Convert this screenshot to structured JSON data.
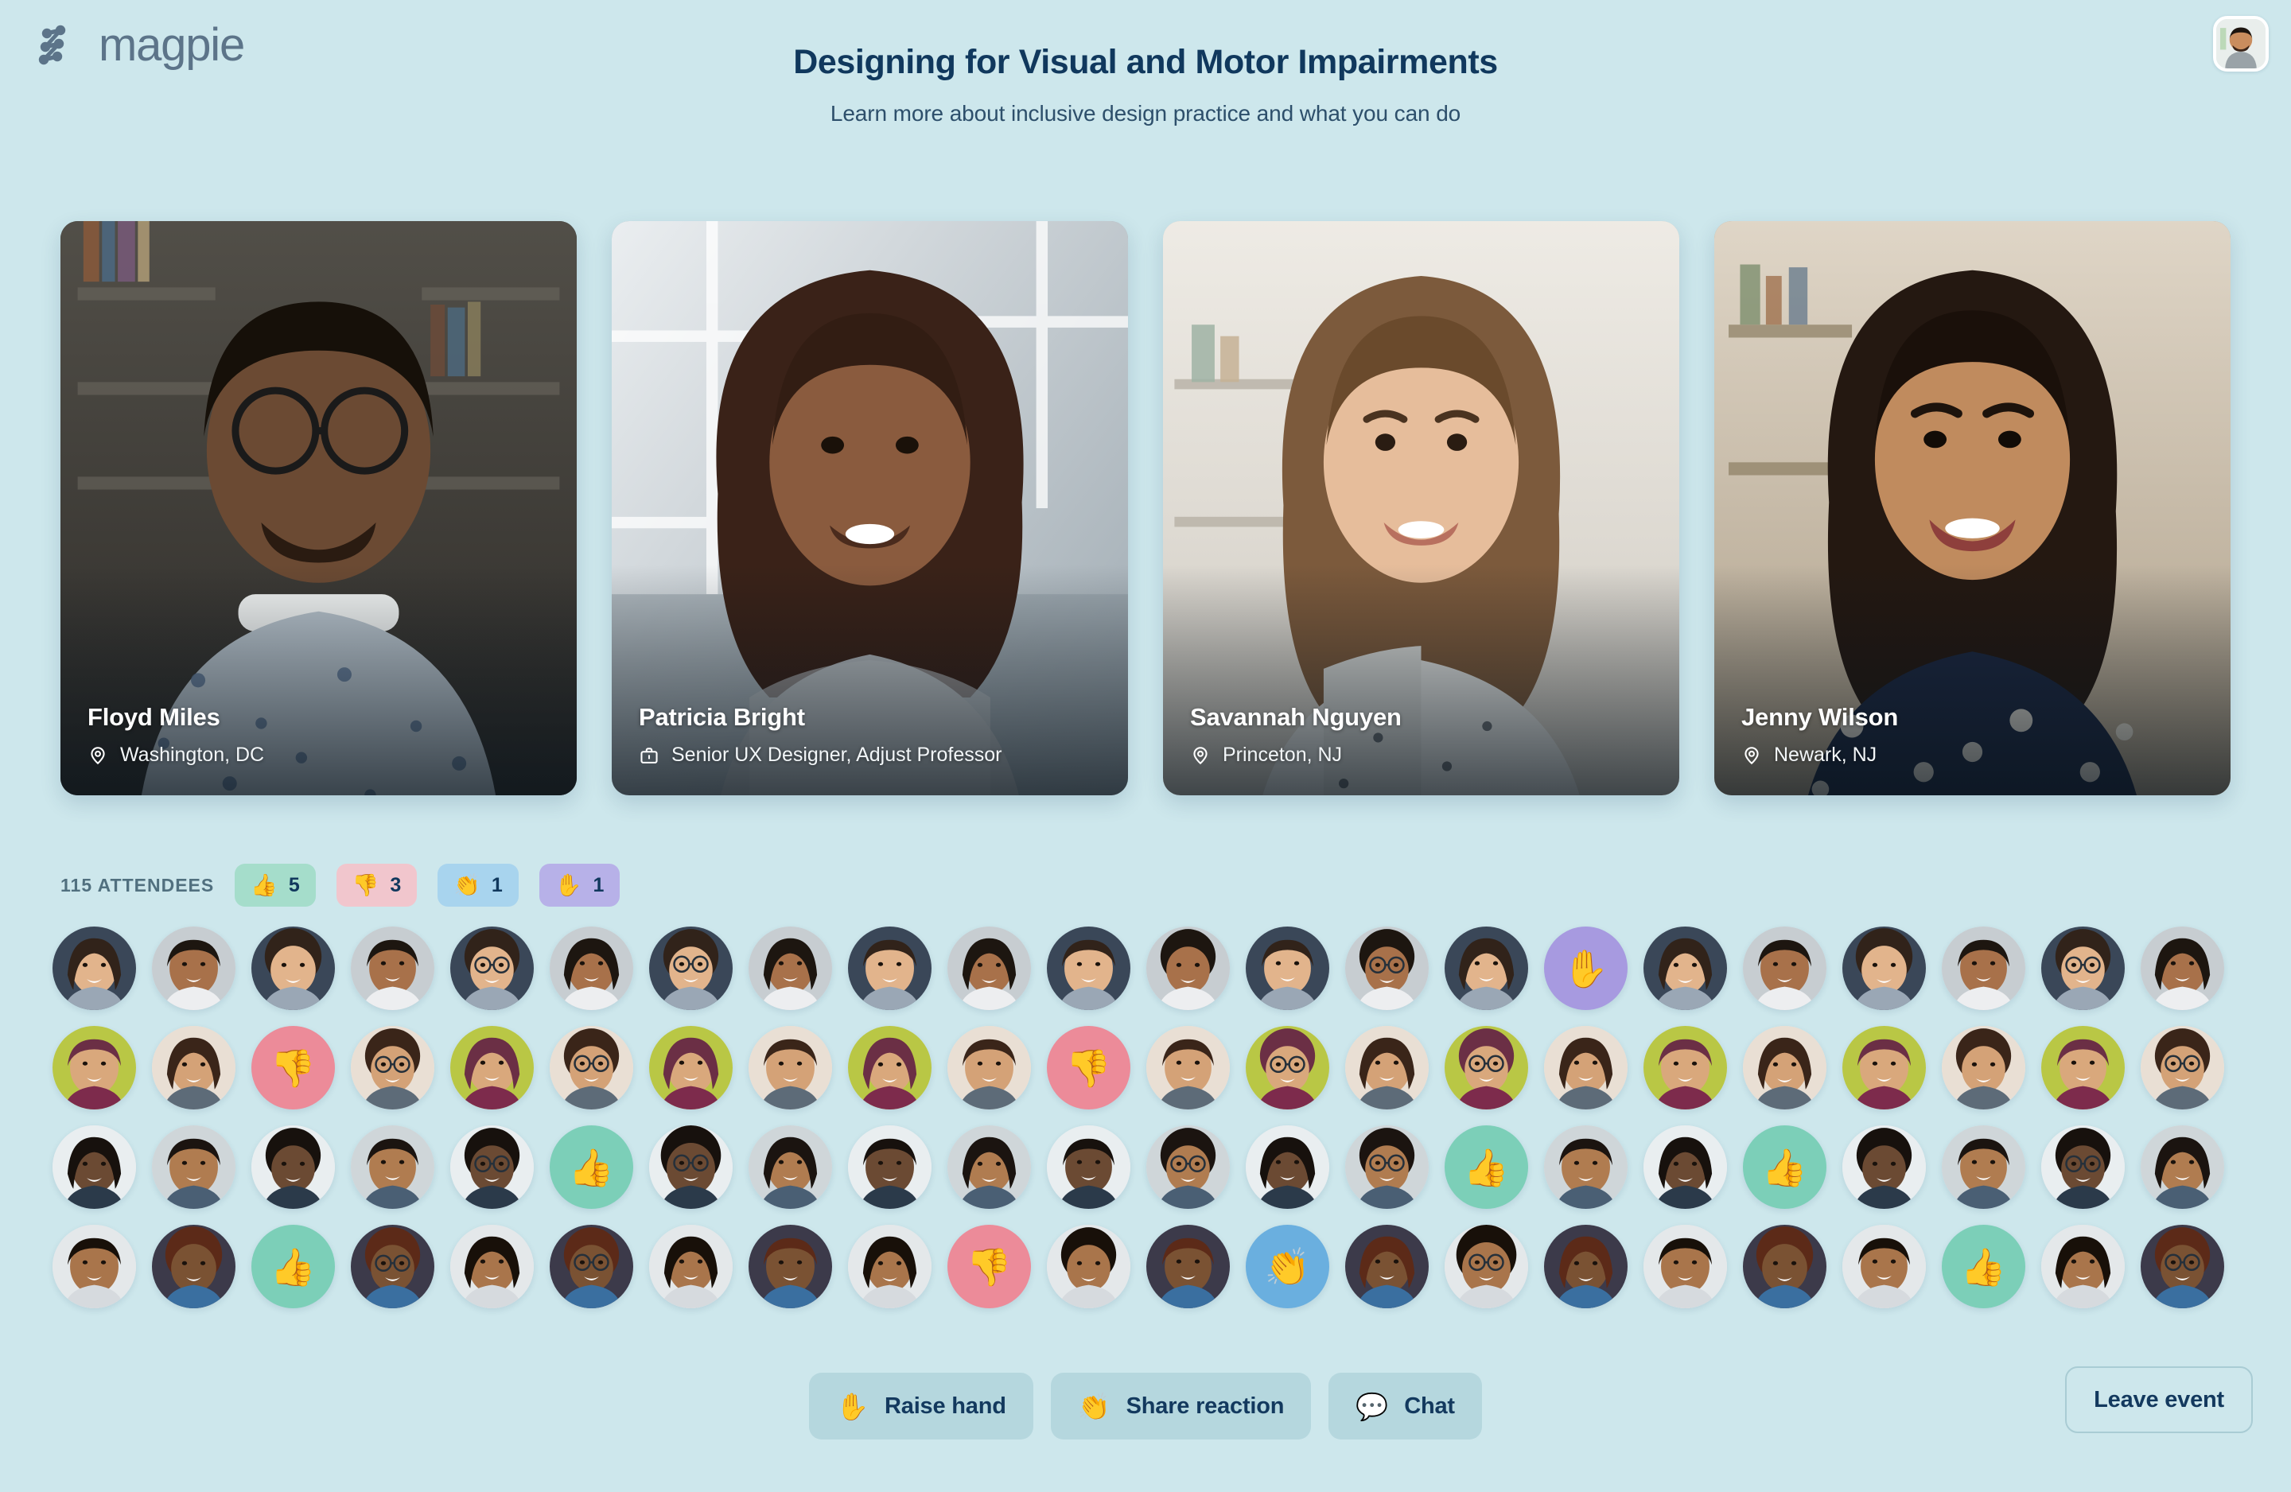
{
  "brand": {
    "name": "magpie",
    "mark_icon": "magpie-node-logo"
  },
  "header": {
    "title": "Designing for Visual and Motor Impairments",
    "subtitle": "Learn more about inclusive design practice and what you can do",
    "me_avatar_icon": "current-user-avatar"
  },
  "speakers": [
    {
      "name": "Floyd Miles",
      "detail": "Washington, DC",
      "detail_icon": "location-pin-icon",
      "skin": "#6b4a33",
      "bg_a": "#4c4a44",
      "bg_b": "#2d2b28",
      "shirt": "#b9c4cd"
    },
    {
      "name": "Patricia Bright",
      "detail": "Senior UX Designer, Adjust Professor",
      "detail_icon": "briefcase-icon",
      "skin": "#8a5b3e",
      "bg_a": "#d8dde2",
      "bg_b": "#9aa6ae",
      "shirt": "#b2b7bb"
    },
    {
      "name": "Savannah Nguyen",
      "detail": "Princeton, NJ",
      "detail_icon": "location-pin-icon",
      "skin": "#e6bd9b",
      "bg_a": "#e9e6e0",
      "bg_b": "#cdc8bf",
      "shirt": "#e3e4e2"
    },
    {
      "name": "Jenny Wilson",
      "detail": "Newark, NJ",
      "detail_icon": "location-pin-icon",
      "skin": "#c08b5e",
      "bg_a": "#dcd3c5",
      "bg_b": "#a99a83",
      "shirt": "#1c2740"
    }
  ],
  "attendees": {
    "count_label": "115 ATTENDEES",
    "reactions": [
      {
        "name": "thumbs-up",
        "emoji": "👍",
        "count": "5",
        "bg": "#a5ddcb"
      },
      {
        "name": "thumbs-down",
        "emoji": "👎",
        "count": "3",
        "bg": "#f1c6cd"
      },
      {
        "name": "clap",
        "emoji": "👏",
        "count": "1",
        "bg": "#a8d4ee"
      },
      {
        "name": "raised-hand",
        "emoji": "✋",
        "count": "1",
        "bg": "#b7b1e8"
      }
    ],
    "columns": 22,
    "reaction_colors": {
      "thumbs-up": "#7ccfb8",
      "thumbs-down": "#ec8b99",
      "clap": "#6aafdf",
      "raised-hand": "#a79ae0"
    },
    "rows": [
      {
        "row": 1,
        "reactions": [
          {
            "col": 16,
            "name": "raised-hand",
            "emoji": "✋"
          }
        ]
      },
      {
        "row": 2,
        "reactions": [
          {
            "col": 3,
            "name": "thumbs-down",
            "emoji": "👎"
          },
          {
            "col": 11,
            "name": "thumbs-down",
            "emoji": "👎"
          }
        ]
      },
      {
        "row": 3,
        "reactions": [
          {
            "col": 6,
            "name": "thumbs-up",
            "emoji": "👍"
          },
          {
            "col": 15,
            "name": "thumbs-up",
            "emoji": "👍"
          },
          {
            "col": 18,
            "name": "thumbs-up",
            "emoji": "👍"
          }
        ]
      },
      {
        "row": 4,
        "reactions": [
          {
            "col": 3,
            "name": "thumbs-up",
            "emoji": "👍"
          },
          {
            "col": 10,
            "name": "thumbs-down",
            "emoji": "👎"
          },
          {
            "col": 13,
            "name": "clap",
            "emoji": "👏"
          },
          {
            "col": 20,
            "name": "thumbs-up",
            "emoji": "👍"
          }
        ]
      }
    ],
    "face_palette": [
      {
        "skin": "#6b4a33",
        "bg": "#e9eef0",
        "hair": "#17110d",
        "shirt": "#2b3a4a"
      },
      {
        "skin": "#8a5b3e",
        "bg": "#59564e",
        "hair": "#2a1c12",
        "shirt": "#e6e2da"
      },
      {
        "skin": "#e6bd9b",
        "bg": "#dfe6e4",
        "hair": "#4a3526",
        "shirt": "#f0f1ef"
      },
      {
        "skin": "#a8714a",
        "bg": "#c7cdd1",
        "hair": "#1d1610",
        "shirt": "#edeef0"
      },
      {
        "skin": "#7a5233",
        "bg": "#3c3a4a",
        "hair": "#5c2a18",
        "shirt": "#3a6fa0"
      },
      {
        "skin": "#c08b5e",
        "bg": "#f0ebe6",
        "hair": "#241a12",
        "shirt": "#e7d9d3"
      },
      {
        "skin": "#8a5b3e",
        "bg": "#5c4433",
        "hair": "#1a120c",
        "shirt": "#e2c3cd"
      },
      {
        "skin": "#d9a87c",
        "bg": "#b9c745",
        "hair": "#6b2f45",
        "shirt": "#7d2b4c"
      },
      {
        "skin": "#c89060",
        "bg": "#d3d8da",
        "hair": "#221811",
        "shirt": "#8a9299"
      },
      {
        "skin": "#e8c6a4",
        "bg": "#e7e9e5",
        "hair": "#b08a57",
        "shirt": "#7a3a72"
      },
      {
        "skin": "#dbb089",
        "bg": "#93b544",
        "hair": "#2b1d14",
        "shirt": "#2d3947"
      },
      {
        "skin": "#b07c50",
        "bg": "#cfd6d9",
        "hair": "#1b1410",
        "shirt": "#4a5f74"
      },
      {
        "skin": "#f0cfae",
        "bg": "#eceee9",
        "hair": "#5e4024",
        "shirt": "#dfe1de"
      },
      {
        "skin": "#8f6140",
        "bg": "#cbd2d6",
        "hair": "#120d09",
        "shirt": "#2f3c4d"
      },
      {
        "skin": "#e2b48c",
        "bg": "#3a4758",
        "hair": "#31231a",
        "shirt": "#9aa7b5"
      },
      {
        "skin": "#a9754b",
        "bg": "#e4e8ea",
        "hair": "#181009",
        "shirt": "#d6dade"
      },
      {
        "skin": "#f2d3b4",
        "bg": "#d6cfc4",
        "hair": "#8b5a2b",
        "shirt": "#b8bcc0"
      },
      {
        "skin": "#7d5434",
        "bg": "#4e4a46",
        "hair": "#0f0b07",
        "shirt": "#e9e6e1"
      },
      {
        "skin": "#d4a277",
        "bg": "#e9dfd4",
        "hair": "#3a2519",
        "shirt": "#5d6b78"
      },
      {
        "skin": "#c5925f",
        "bg": "#b9c4ca",
        "hair": "#201611",
        "shirt": "#36414f"
      },
      {
        "skin": "#eccaa8",
        "bg": "#dde4e7",
        "hair": "#6b4a2a",
        "shirt": "#c3c9cd"
      },
      {
        "skin": "#9a6a45",
        "bg": "#4a5560",
        "hair": "#14100c",
        "shirt": "#dbe0e4"
      }
    ]
  },
  "toolbar": {
    "buttons": [
      {
        "name": "raise-hand",
        "emoji": "✋",
        "label": "Raise hand"
      },
      {
        "name": "share-reaction",
        "emoji": "👏",
        "label": "Share reaction"
      },
      {
        "name": "chat",
        "emoji": "💬",
        "label": "Chat"
      }
    ],
    "leave_label": "Leave event"
  },
  "colors": {
    "page_bg": "#cde7ec",
    "brand": "#5c7489",
    "text_dark": "#10385d",
    "toolbar_btn_bg": "#b5d7de"
  }
}
